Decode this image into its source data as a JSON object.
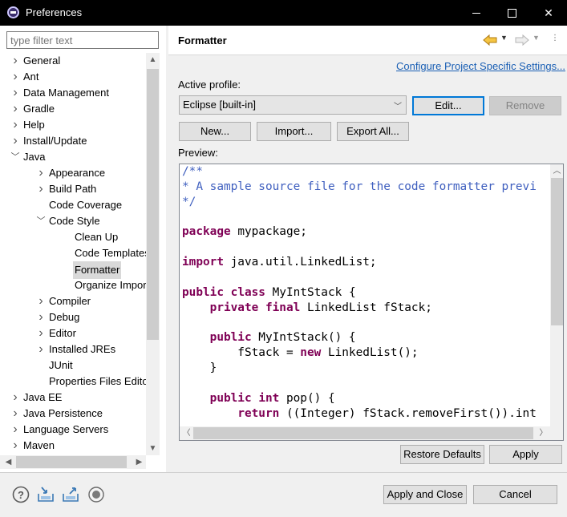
{
  "window": {
    "title": "Preferences"
  },
  "filter": {
    "placeholder": "type filter text"
  },
  "tree": [
    {
      "label": "General",
      "depth": 0,
      "chevron": ">"
    },
    {
      "label": "Ant",
      "depth": 0,
      "chevron": ">"
    },
    {
      "label": "Data Management",
      "depth": 0,
      "chevron": ">"
    },
    {
      "label": "Gradle",
      "depth": 0,
      "chevron": ">"
    },
    {
      "label": "Help",
      "depth": 0,
      "chevron": ">"
    },
    {
      "label": "Install/Update",
      "depth": 0,
      "chevron": ">"
    },
    {
      "label": "Java",
      "depth": 0,
      "chevron": "v"
    },
    {
      "label": "Appearance",
      "depth": 1,
      "chevron": ">"
    },
    {
      "label": "Build Path",
      "depth": 1,
      "chevron": ">"
    },
    {
      "label": "Code Coverage",
      "depth": 1,
      "chevron": ""
    },
    {
      "label": "Code Style",
      "depth": 1,
      "chevron": "v"
    },
    {
      "label": "Clean Up",
      "depth": 2,
      "chevron": ""
    },
    {
      "label": "Code Templates",
      "depth": 2,
      "chevron": ""
    },
    {
      "label": "Formatter",
      "depth": 2,
      "chevron": "",
      "selected": true
    },
    {
      "label": "Organize Imports",
      "depth": 2,
      "chevron": ""
    },
    {
      "label": "Compiler",
      "depth": 1,
      "chevron": ">"
    },
    {
      "label": "Debug",
      "depth": 1,
      "chevron": ">"
    },
    {
      "label": "Editor",
      "depth": 1,
      "chevron": ">"
    },
    {
      "label": "Installed JREs",
      "depth": 1,
      "chevron": ">"
    },
    {
      "label": "JUnit",
      "depth": 1,
      "chevron": ""
    },
    {
      "label": "Properties Files Editor",
      "depth": 1,
      "chevron": ""
    },
    {
      "label": "Java EE",
      "depth": 0,
      "chevron": ">"
    },
    {
      "label": "Java Persistence",
      "depth": 0,
      "chevron": ">"
    },
    {
      "label": "Language Servers",
      "depth": 0,
      "chevron": ">"
    },
    {
      "label": "Maven",
      "depth": 0,
      "chevron": ">"
    }
  ],
  "page": {
    "title": "Formatter",
    "configure_link": "Configure Project Specific Settings...",
    "active_profile_label": "Active profile:",
    "profile_value": "Eclipse [built-in]",
    "edit_label": "Edit...",
    "remove_label": "Remove",
    "new_label": "New...",
    "import_label": "Import...",
    "export_label": "Export All...",
    "preview_label": "Preview:"
  },
  "code_lines": [
    [
      {
        "t": "/**",
        "c": "comment"
      }
    ],
    [
      {
        "t": "* A sample source file for the code formatter previ",
        "c": "comment"
      }
    ],
    [
      {
        "t": "*/",
        "c": "comment"
      }
    ],
    [],
    [
      {
        "t": "package",
        "c": "kw"
      },
      {
        "t": " mypackage;",
        "c": ""
      }
    ],
    [],
    [
      {
        "t": "import",
        "c": "kw"
      },
      {
        "t": " java.util.LinkedList;",
        "c": ""
      }
    ],
    [],
    [
      {
        "t": "public",
        "c": "kw"
      },
      {
        "t": " ",
        "c": ""
      },
      {
        "t": "class",
        "c": "kw"
      },
      {
        "t": " MyIntStack {",
        "c": ""
      }
    ],
    [
      {
        "t": "    ",
        "c": ""
      },
      {
        "t": "private",
        "c": "kw"
      },
      {
        "t": " ",
        "c": ""
      },
      {
        "t": "final",
        "c": "kw"
      },
      {
        "t": " LinkedList fStack;",
        "c": ""
      }
    ],
    [],
    [
      {
        "t": "    ",
        "c": ""
      },
      {
        "t": "public",
        "c": "kw"
      },
      {
        "t": " MyIntStack() {",
        "c": ""
      }
    ],
    [
      {
        "t": "        fStack = ",
        "c": ""
      },
      {
        "t": "new",
        "c": "kw"
      },
      {
        "t": " LinkedList();",
        "c": ""
      }
    ],
    [
      {
        "t": "    }",
        "c": ""
      }
    ],
    [],
    [
      {
        "t": "    ",
        "c": ""
      },
      {
        "t": "public",
        "c": "kw"
      },
      {
        "t": " ",
        "c": ""
      },
      {
        "t": "int",
        "c": "kw"
      },
      {
        "t": " pop() {",
        "c": ""
      }
    ],
    [
      {
        "t": "        ",
        "c": ""
      },
      {
        "t": "return",
        "c": "kw"
      },
      {
        "t": " ((Integer) fStack.removeFirst()).int",
        "c": ""
      }
    ]
  ],
  "actions": {
    "restore_defaults": "Restore Defaults",
    "apply": "Apply",
    "apply_and_close": "Apply and Close",
    "cancel": "Cancel"
  },
  "bottom_icons": [
    "help-icon",
    "import-icon",
    "export-icon",
    "record-icon"
  ],
  "colors": {
    "link": "#1a5fb4",
    "keyword": "#7f0055",
    "comment": "#3f5fbf",
    "selection": "#d9d9d9",
    "focus": "#0078d7"
  }
}
